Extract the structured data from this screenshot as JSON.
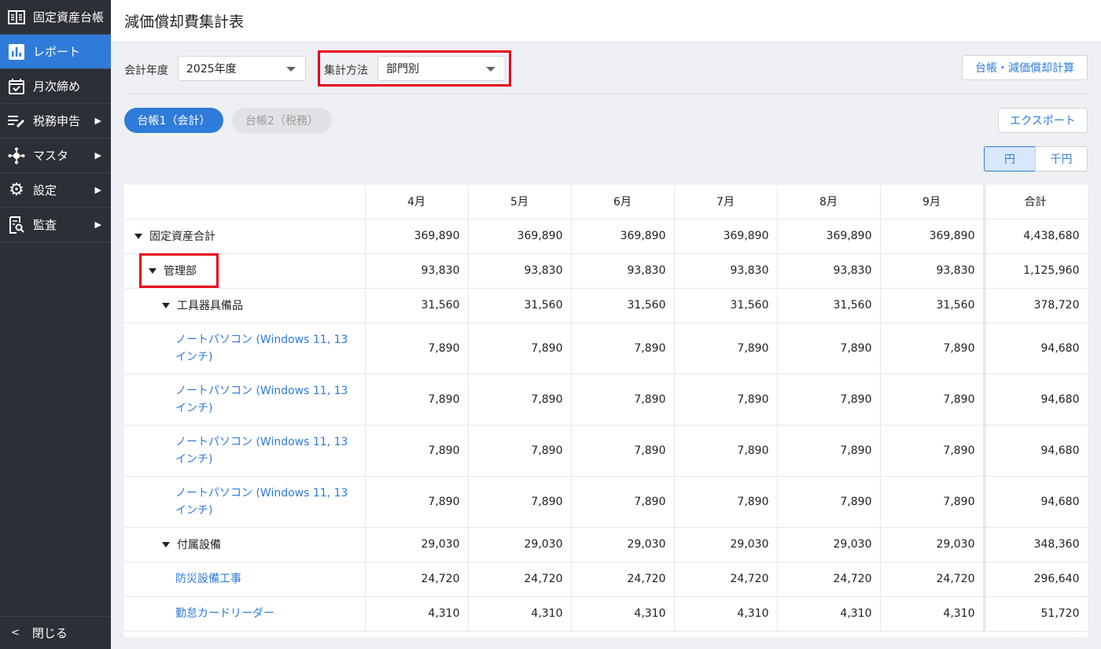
{
  "sidebar": {
    "items": [
      {
        "label": "固定資産台帳",
        "icon": "ledger-icon",
        "arrow": false
      },
      {
        "label": "レポート",
        "icon": "bar-chart-icon",
        "arrow": false
      },
      {
        "label": "月次締め",
        "icon": "calendar-check-icon",
        "arrow": false
      },
      {
        "label": "税務申告",
        "icon": "edit-list-icon",
        "arrow": true
      },
      {
        "label": "マスタ",
        "icon": "hub-icon",
        "arrow": true
      },
      {
        "label": "設定",
        "icon": "gear-icon",
        "arrow": true
      },
      {
        "label": "監査",
        "icon": "audit-search-icon",
        "arrow": true
      }
    ],
    "close_label": "閉じる"
  },
  "header": {
    "title": "減価償却費集計表"
  },
  "filters": {
    "fiscal_year_label": "会計年度",
    "fiscal_year_value": "2025年度",
    "method_label": "集計方法",
    "method_value": "部門別",
    "calc_button": "台帳・減価償却計算"
  },
  "ledger_tabs": [
    "台帳1（会計）",
    "台帳2（税務）"
  ],
  "export_button": "エクスポート",
  "unit_toggle": [
    "円",
    "千円"
  ],
  "table": {
    "headers": [
      "4月",
      "5月",
      "6月",
      "7月",
      "8月",
      "9月",
      "合計"
    ],
    "rows": [
      {
        "name": "固定資産合計",
        "values": [
          "369,890",
          "369,890",
          "369,890",
          "369,890",
          "369,890",
          "369,890",
          "4,438,680"
        ]
      },
      {
        "name": "管理部",
        "values": [
          "93,830",
          "93,830",
          "93,830",
          "93,830",
          "93,830",
          "93,830",
          "1,125,960"
        ]
      },
      {
        "name": "工具器具備品",
        "values": [
          "31,560",
          "31,560",
          "31,560",
          "31,560",
          "31,560",
          "31,560",
          "378,720"
        ]
      },
      {
        "name": "ノートパソコン (Windows 11, 13インチ)",
        "values": [
          "7,890",
          "7,890",
          "7,890",
          "7,890",
          "7,890",
          "7,890",
          "94,680"
        ]
      },
      {
        "name": "ノートパソコン (Windows 11, 13インチ)",
        "values": [
          "7,890",
          "7,890",
          "7,890",
          "7,890",
          "7,890",
          "7,890",
          "94,680"
        ]
      },
      {
        "name": "ノートパソコン (Windows 11, 13インチ)",
        "values": [
          "7,890",
          "7,890",
          "7,890",
          "7,890",
          "7,890",
          "7,890",
          "94,680"
        ]
      },
      {
        "name": "ノートパソコン (Windows 11, 13インチ)",
        "values": [
          "7,890",
          "7,890",
          "7,890",
          "7,890",
          "7,890",
          "7,890",
          "94,680"
        ]
      },
      {
        "name": "付属設備",
        "values": [
          "29,030",
          "29,030",
          "29,030",
          "29,030",
          "29,030",
          "29,030",
          "348,360"
        ]
      },
      {
        "name": "防災設備工事",
        "values": [
          "24,720",
          "24,720",
          "24,720",
          "24,720",
          "24,720",
          "24,720",
          "296,640"
        ]
      },
      {
        "name": "勤怠カードリーダー",
        "values": [
          "4,310",
          "4,310",
          "4,310",
          "4,310",
          "4,310",
          "4,310",
          "51,720"
        ]
      }
    ]
  }
}
